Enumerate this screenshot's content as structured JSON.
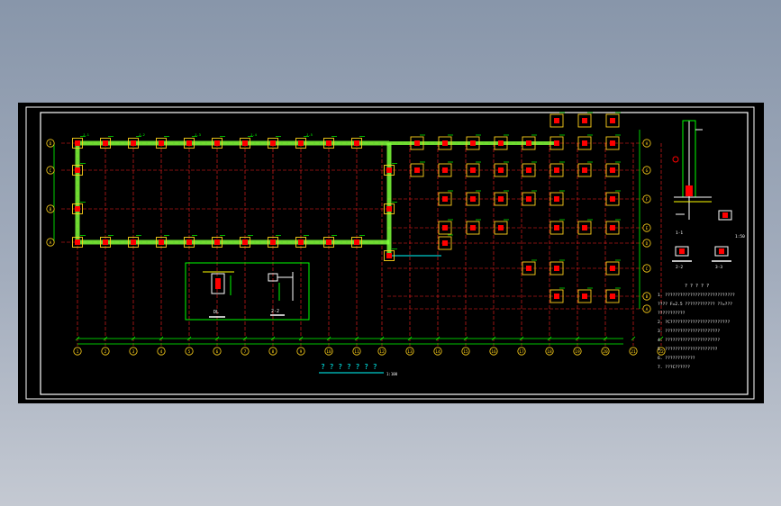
{
  "drawing": {
    "title": "? ? ? ? ? ? ?",
    "title_scale": "1:100",
    "colors": {
      "background": "#000000",
      "frame": "#ffffff",
      "axis": "#ff2020",
      "dimension": "#00ff00",
      "wall": "#7cff3a",
      "column": "#ff0000",
      "footing": "#ffd21a",
      "text": "#ffffff",
      "tag": "#00ffff",
      "highlight": "#ffff00"
    },
    "axes": {
      "bottom": [
        "1",
        "2",
        "3",
        "4",
        "5",
        "6",
        "7",
        "8",
        "9",
        "10",
        "11",
        "12",
        "13",
        "14",
        "15",
        "16",
        "17",
        "18",
        "19",
        "20",
        "21",
        "22"
      ],
      "left": [
        "D",
        "C",
        "B",
        "A"
      ],
      "right": [
        "H",
        "G",
        "F",
        "E",
        "D",
        "C",
        "B",
        "A"
      ]
    },
    "footing_labels": [
      "J-1",
      "J-2",
      "J-3",
      "J-4",
      "J-5"
    ],
    "detail": {
      "label_a": "DL",
      "label_b": "2-2"
    },
    "section_labels": [
      "1-1",
      "1:50",
      "2-2",
      "3-3"
    ],
    "notes": [
      "1. ????????????????????????????",
      "   ????  F=2.5 ???????????? ??=???",
      "   ???????????",
      "2. ?C????????????????????????",
      "3. ??????????????????????",
      "4. ??????????????????????",
      "5. ?????????????????????",
      "6. ????????????",
      "7. ???C??????"
    ]
  }
}
